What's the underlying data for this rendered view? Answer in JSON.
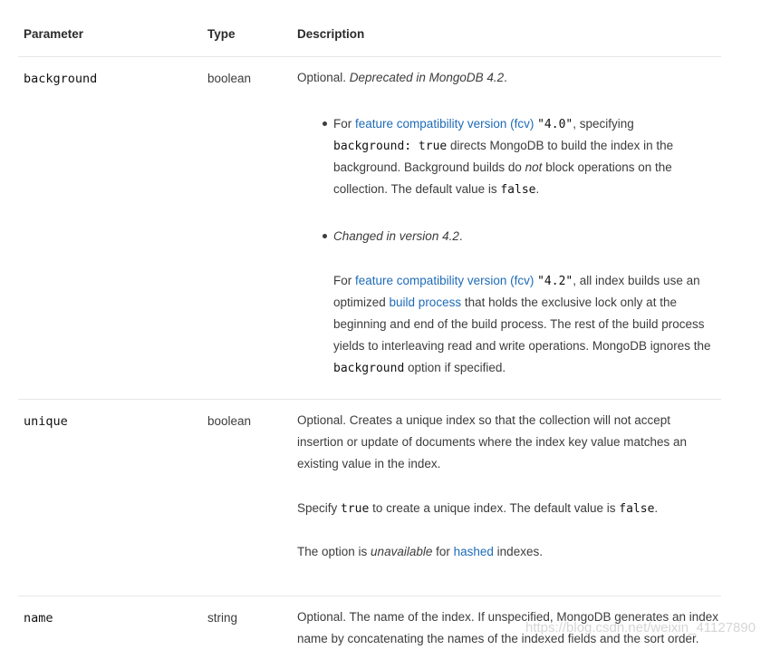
{
  "headers": {
    "parameter": "Parameter",
    "type": "Type",
    "description": "Description"
  },
  "rows": {
    "background": {
      "param": "background",
      "type": "boolean",
      "optional": "Optional. ",
      "deprecated": "Deprecated in MongoDB 4.2",
      "deprecated_end": ".",
      "b1_for": "For ",
      "b1_link": "feature compatibility version (fcv)",
      "b1_code40": "\"4.0\"",
      "b1_spec": ", specifying",
      "b1_code_bg": "background: true",
      "b1_directs": " directs MongoDB to build the index in the",
      "b1_line3a": "background. Background builds do ",
      "b1_not": "not",
      "b1_line3b": " block operations on the",
      "b1_line4": "collection. The default value is ",
      "b1_false": "false",
      "b1_dot": ".",
      "b2_changed": "Changed in version 4.2",
      "b2_dot": ".",
      "p_for": "For ",
      "p_link": "feature compatibility version (fcv)",
      "p_code42": "\"4.2\"",
      "p_rest1": ", all index builds use an",
      "p_l2a": "optimized ",
      "p_build_link": "build process",
      "p_l2b": " that holds the exclusive lock only at the",
      "p_l3": "beginning and end of the build process. The rest of the build process",
      "p_l4": "yields to interleaving read and write operations. MongoDB ignores the",
      "p_code_bg": "background",
      "p_l5": " option if specified."
    },
    "unique": {
      "param": "unique",
      "type": "boolean",
      "l1": "Optional. Creates a unique index so that the collection will not accept",
      "l2": "insertion or update of documents where the index key value matches an",
      "l3": "existing value in the index.",
      "s_specify": "Specify ",
      "s_true": "true",
      "s_mid": " to create a unique index. The default value is ",
      "s_false": "false",
      "s_dot": ".",
      "o_start": "The option is ",
      "o_unavail": "unavailable",
      "o_for": " for ",
      "o_hashed": "hashed",
      "o_end": " indexes."
    },
    "name": {
      "param": "name",
      "type": "string",
      "l1": "Optional. The name of the index. If unspecified, MongoDB generates an index",
      "l2": "name by concatenating the names of the indexed fields and the sort order."
    }
  },
  "watermark": "https://blog.csdn.net/weixin_41127890",
  "colors": {
    "link": "#1e6bb8",
    "text": "#3c3c3c",
    "divider": "#e7e7e7"
  }
}
